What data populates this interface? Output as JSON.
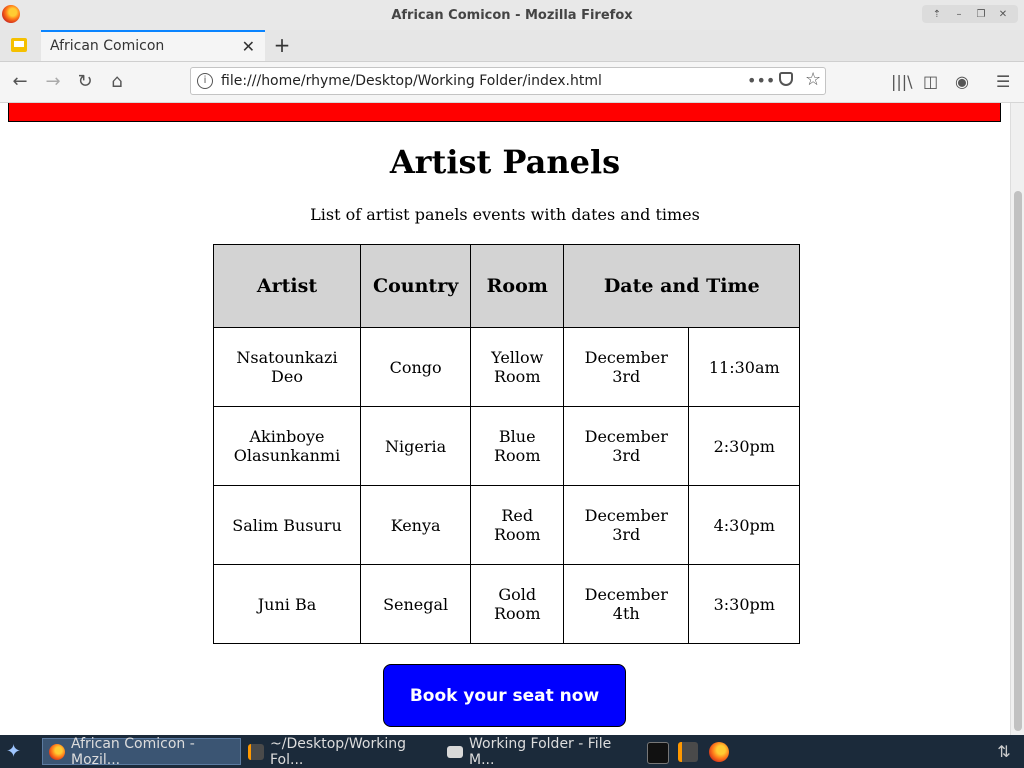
{
  "window": {
    "title": "African Comicon - Mozilla Firefox"
  },
  "tab": {
    "label": "African Comicon",
    "close": "✕",
    "new": "+"
  },
  "address": {
    "url": "file:///home/rhyme/Desktop/Working Folder/index.html",
    "more": "•••"
  },
  "page": {
    "heading": "Artist Panels",
    "subtitle": "List of artist panels events with dates and times",
    "table": {
      "headers": [
        "Artist",
        "Country",
        "Room",
        "Date and Time"
      ],
      "rows": [
        {
          "artist": "Nsatounkazi Deo",
          "country": "Congo",
          "room": "Yellow Room",
          "date": "December 3rd",
          "time": "11:30am"
        },
        {
          "artist": "Akinboye Olasunkanmi",
          "country": "Nigeria",
          "room": "Blue Room",
          "date": "December 3rd",
          "time": "2:30pm"
        },
        {
          "artist": "Salim Busuru",
          "country": "Kenya",
          "room": "Red Room",
          "date": "December 3rd",
          "time": "4:30pm"
        },
        {
          "artist": "Juni Ba",
          "country": "Senegal",
          "room": "Gold Room",
          "date": "December 4th",
          "time": "3:30pm"
        }
      ]
    },
    "book_button": "Book your seat now"
  },
  "taskbar": {
    "items": [
      {
        "label": "African Comicon - Mozil..."
      },
      {
        "label": "~/Desktop/Working Fol..."
      },
      {
        "label": "Working Folder - File M..."
      }
    ]
  },
  "colors": {
    "accent": "#0a84ff",
    "banner": "#ff0000",
    "button": "#0000ff"
  }
}
